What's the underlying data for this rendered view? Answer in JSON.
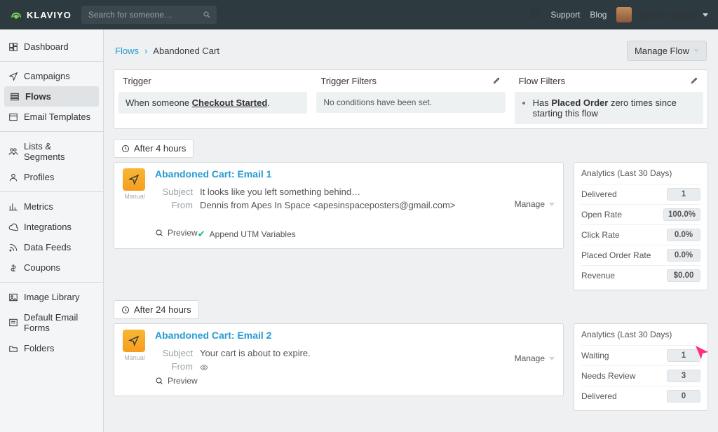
{
  "topbar": {
    "search_placeholder": "Search for someone…",
    "links": {
      "support": "Support",
      "blog": "Blog"
    },
    "account_name": "Apes In Space"
  },
  "sidebar": {
    "items": [
      {
        "label": "Dashboard",
        "icon": "dashboard-icon"
      },
      {
        "label": "Campaigns",
        "icon": "send-icon"
      },
      {
        "label": "Flows",
        "icon": "flows-icon",
        "active": true
      },
      {
        "label": "Email Templates",
        "icon": "templates-icon"
      },
      {
        "label": "Lists & Segments",
        "icon": "people-icon"
      },
      {
        "label": "Profiles",
        "icon": "profile-icon"
      },
      {
        "label": "Metrics",
        "icon": "metrics-icon"
      },
      {
        "label": "Integrations",
        "icon": "cloud-icon"
      },
      {
        "label": "Data Feeds",
        "icon": "feed-icon"
      },
      {
        "label": "Coupons",
        "icon": "dollar-icon"
      },
      {
        "label": "Image Library",
        "icon": "image-icon"
      },
      {
        "label": "Default Email Forms",
        "icon": "form-icon"
      },
      {
        "label": "Folders",
        "icon": "folder-icon"
      }
    ]
  },
  "breadcrumb": {
    "root": "Flows",
    "leaf": "Abandoned Cart"
  },
  "manage_flow_label": "Manage Flow",
  "strip": {
    "trigger": {
      "title": "Trigger",
      "prefix": "When someone ",
      "metric": "Checkout Started",
      "suffix": "."
    },
    "filters": {
      "title": "Trigger Filters",
      "text": "No conditions have been set."
    },
    "flow": {
      "title": "Flow Filters",
      "text_pre": "Has ",
      "text_b": "Placed Order",
      "text_post": " zero times since starting this flow"
    }
  },
  "nodes": [
    {
      "delay": "After 4 hours",
      "mode": "Manual",
      "title": "Abandoned Cart: Email 1",
      "subject": "It looks like you left something behind…",
      "from": "Dennis from Apes In Space <apesinspaceposters@gmail.com>",
      "preview_label": "Preview",
      "utm_label": "Append UTM Variables",
      "manage_label": "Manage",
      "analytics_title": "Analytics (Last 30 Days)",
      "stats": [
        {
          "l": "Delivered",
          "n": "1"
        },
        {
          "l": "Open Rate",
          "n": "100.0%"
        },
        {
          "l": "Click Rate",
          "n": "0.0%"
        },
        {
          "l": "Placed Order Rate",
          "n": "0.0%"
        },
        {
          "l": "Revenue",
          "n": "$0.00"
        }
      ]
    },
    {
      "delay": "After 24 hours",
      "mode": "Manual",
      "title": "Abandoned Cart: Email 2",
      "subject": "Your cart is about to expire.",
      "from": "",
      "preview_label": "Preview",
      "utm_label": "",
      "manage_label": "Manage",
      "analytics_title": "Analytics (Last 30 Days)",
      "has_cursor": true,
      "stats": [
        {
          "l": "Waiting",
          "n": "1"
        },
        {
          "l": "Needs Review",
          "n": "3"
        },
        {
          "l": "Delivered",
          "n": "0"
        }
      ]
    }
  ],
  "labels": {
    "subject": "Subject",
    "from": "From"
  }
}
